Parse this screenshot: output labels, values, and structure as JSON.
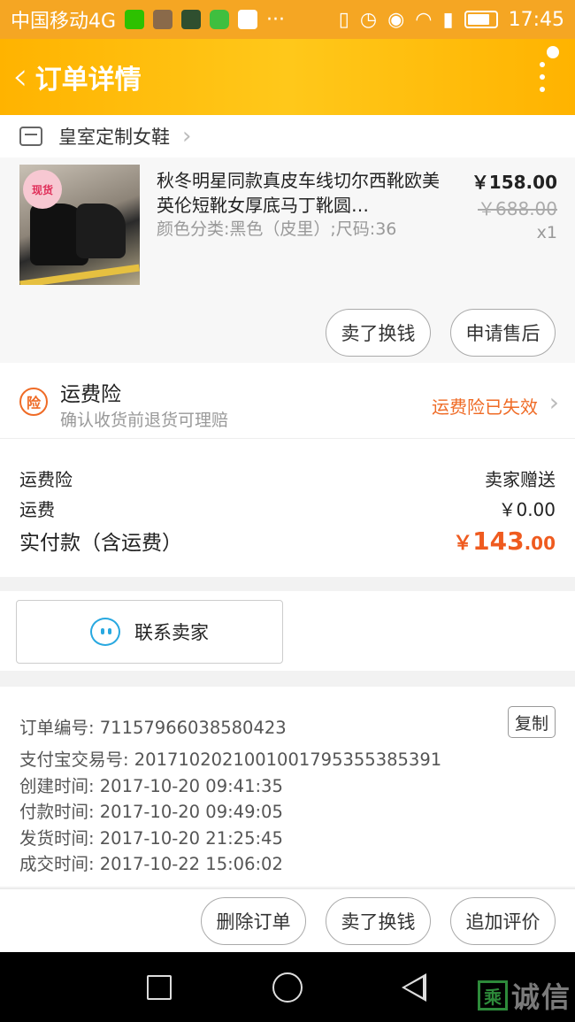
{
  "status_bar": {
    "carrier": "中国移动4G",
    "dots": "···",
    "time": "17:45"
  },
  "nav": {
    "title": "订单详情"
  },
  "shop": {
    "name": "皇室定制女鞋"
  },
  "product": {
    "badge": "现货",
    "title": "秋冬明星同款真皮车线切尔西靴欧美英伦短靴女厚底马丁靴圆…",
    "spec": "颜色分类:黑色（皮里）;尺码:36",
    "price": "￥158.00",
    "original_price": "￥688.00",
    "quantity": "x1",
    "actions": [
      "卖了换钱",
      "申请售后"
    ]
  },
  "insurance": {
    "badge": "险",
    "title": "运费险",
    "subtitle": "确认收货前退货可理赔",
    "status": "运费险已失效"
  },
  "fees": [
    {
      "label": "运费险",
      "value": "卖家赠送"
    },
    {
      "label": "运费",
      "value": "￥0.00"
    }
  ],
  "paid": {
    "label": "实付款（含运费）",
    "symbol": "￥",
    "integer": "143",
    "decimal": ".00",
    "color": "#ef5b1f"
  },
  "contact": {
    "label": "联系卖家"
  },
  "order_info": {
    "copy_label": "复制",
    "lines": [
      "订单编号: 71157966038580423",
      "支付宝交易号: 2017102021001001795355385391",
      "创建时间: 2017-10-20 09:41:35",
      "付款时间: 2017-10-20 09:49:05",
      "发货时间: 2017-10-20 21:25:45",
      "成交时间: 2017-10-22 15:06:02"
    ]
  },
  "bottom_actions": [
    "删除订单",
    "卖了换钱",
    "追加评价"
  ],
  "watermark": {
    "box": "乘",
    "text": "诚信"
  },
  "colors": {
    "accent": "#ffb300",
    "orange": "#ef6b26",
    "chat_blue": "#28a8e0"
  }
}
